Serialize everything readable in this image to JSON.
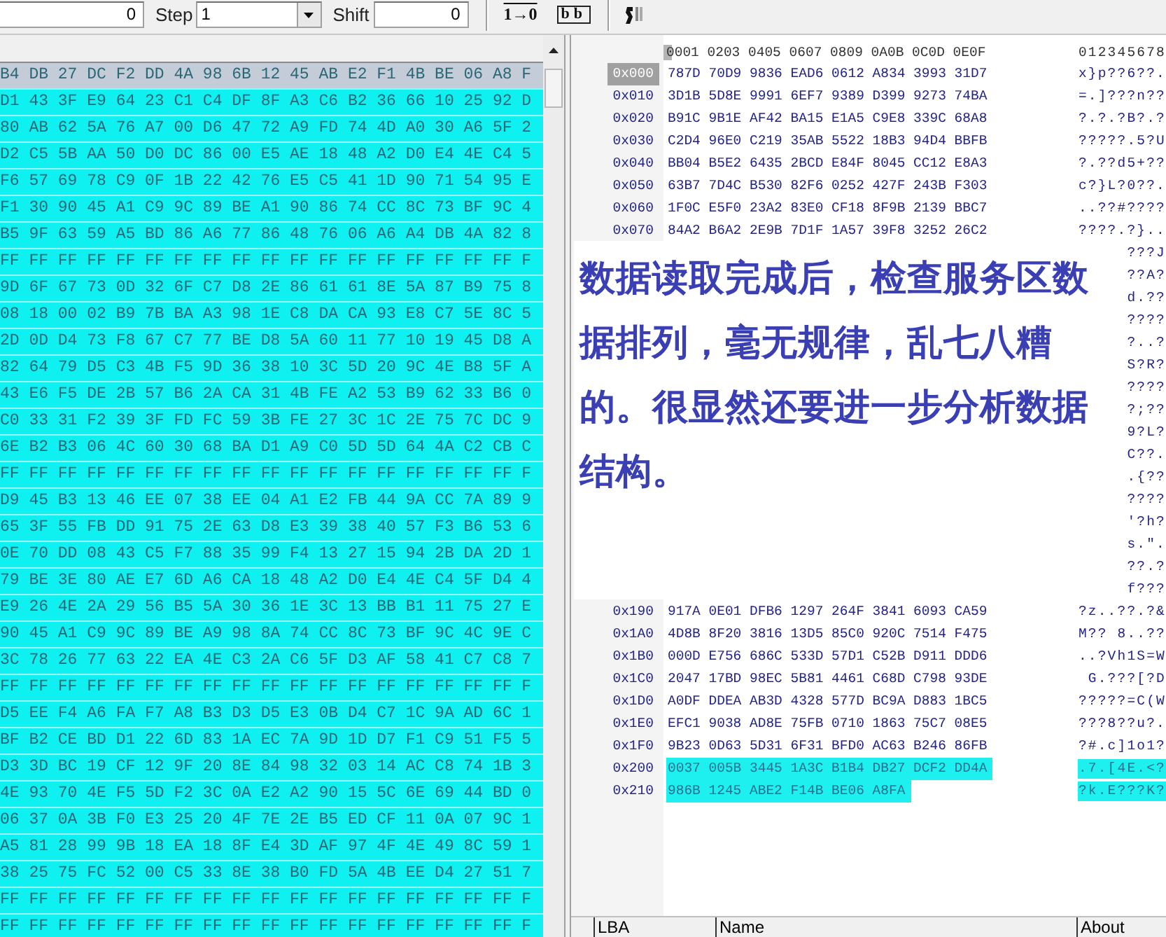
{
  "toolbar": {
    "offset_value": "0",
    "step_label": "Step",
    "step_value": "1",
    "shift_label": "Shift",
    "shift_value": "0",
    "invert_button": "1→0",
    "bytes_button": "bb"
  },
  "left_panel": {
    "rows": [
      {
        "bytes": "B4 DB 27 DC F2 DD 4A 98 6B 12 45 AB E2 F1 4B BE 06 A8 F",
        "current": true
      },
      {
        "bytes": "D1 43 3F E9 64 23 C1 C4 DF 8F A3 C6 B2 36 66 10 25 92 D",
        "current": false
      },
      {
        "bytes": "80 AB 62 5A 76 A7 00 D6 47 72 A9 FD 74 4D A0 30 A6 5F 2",
        "current": false
      },
      {
        "bytes": "D2 C5 5B AA 50 D0 DC 86 00 E5 AE 18 48 A2 D0 E4 4E C4 5",
        "current": false
      },
      {
        "bytes": "F6 57 69 78 C9 0F 1B 22 42 76 E5 C5 41 1D 90 71 54 95 E",
        "current": false
      },
      {
        "bytes": "F1 30 90 45 A1 C9 9C 89 BE A1 90 86 74 CC 8C 73 BF 9C 4",
        "current": false
      },
      {
        "bytes": "B5 9F 63 59 A5 BD 86 A6 77 86 48 76 06 A6 A4 DB 4A 82 8",
        "current": false
      },
      {
        "bytes": "FF FF FF FF FF FF FF FF FF FF FF FF FF FF FF FF FF FF F",
        "current": false
      },
      {
        "bytes": "9D 6F 67 73 0D 32 6F C7 D8 2E 86 61 61 8E 5A 87 B9 75 8",
        "current": false
      },
      {
        "bytes": "08 18 00 02 B9 7B BA A3 98 1E C8 DA CA 93 E8 C7 5E 8C 5",
        "current": false
      },
      {
        "bytes": "2D 0D D4 73 F8 67 C7 77 BE D8 5A 60 11 77 10 19 45 D8 A",
        "current": false
      },
      {
        "bytes": "82 64 79 D5 C3 4B F5 9D 36 38 10 3C 5D 20 9C 4E B8 5F A",
        "current": false
      },
      {
        "bytes": "43 E6 F5 DE 2B 57 B6 2A CA 31 4B FE A2 53 B9 62 33 B6 0",
        "current": false
      },
      {
        "bytes": "C0 33 31 F2 39 3F FD FC 59 3B FE 27 3C 1C 2E 75 7C DC 9",
        "current": false
      },
      {
        "bytes": "6E B2 B3 06 4C 60 30 68 BA D1 A9 C0 5D 5D 64 4A C2 CB C",
        "current": false
      },
      {
        "bytes": "FF FF FF FF FF FF FF FF FF FF FF FF FF FF FF FF FF FF F",
        "current": false
      },
      {
        "bytes": "D9 45 B3 13 46 EE 07 38 EE 04 A1 E2 FB 44 9A CC 7A 89 9",
        "current": false
      },
      {
        "bytes": "65 3F 55 FB DD 91 75 2E 63 D8 E3 39 38 40 57 F3 B6 53 6",
        "current": false
      },
      {
        "bytes": "0E 70 DD 08 43 C5 F7 88 35 99 F4 13 27 15 94 2B DA 2D 1",
        "current": false
      },
      {
        "bytes": "79 BE 3E 80 AE E7 6D A6 CA 18 48 A2 D0 E4 4E C4 5F D4 4",
        "current": false
      },
      {
        "bytes": "E9 26 4E 2A 29 56 B5 5A 30 36 1E 3C 13 BB B1 11 75 27 E",
        "current": false
      },
      {
        "bytes": "90 45 A1 C9 9C 89 BE A9 98 8A 74 CC 8C 73 BF 9C 4C 9E C",
        "current": false
      },
      {
        "bytes": "3C 78 26 77 63 22 EA 4E C3 2A C6 5F D3 AF 58 41 C7 C8 7",
        "current": false
      },
      {
        "bytes": "FF FF FF FF FF FF FF FF FF FF FF FF FF FF FF FF FF FF F",
        "current": false
      },
      {
        "bytes": "D5 EE F4 A6 FA F7 A8 B3 D3 D5 E3 0B D4 C7 1C 9A AD 6C 1",
        "current": false
      },
      {
        "bytes": "BF B2 CE BD D1 22 6D 83 1A EC 7A 9D 1D D7 F1 C9 51 F5 5",
        "current": false
      },
      {
        "bytes": "D3 3D BC 19 CF 12 9F 20 8E 84 98 32 03 14 AC C8 74 1B 3",
        "current": false
      },
      {
        "bytes": "4E 93 70 4E F5 5D F2 3C 0A E2 A2 90 15 5C 6E 69 44 BD 0",
        "current": false
      },
      {
        "bytes": "06 37 0A 3B F0 E3 25 20 4F 7E 2E B5 ED CF 11 0A 07 9C 1",
        "current": false
      },
      {
        "bytes": "A5 81 28 99 9B 18 EA 18 8F E4 3D AF 97 4F 4E 49 8C 59 1",
        "current": false
      },
      {
        "bytes": "38 25 75 FC 52 00 C5 33 8E 38 B0 FD 5A 4B EE D4 27 51 7",
        "current": false
      },
      {
        "bytes": "FF FF FF FF FF FF FF FF FF FF FF FF FF FF FF FF FF FF F",
        "current": false
      },
      {
        "bytes": "FF FF FF FF FF FF FF FF FF FF FF FF FF FF FF FF FF FF F",
        "current": false
      }
    ]
  },
  "right_panel": {
    "header_hex": "0001 0203 0405 0607 0809 0A0B 0C0D 0E0F",
    "header_ascii": "012345678",
    "rows": [
      {
        "offset": "0x000",
        "hex": "787D 70D9 9836 EAD6 0612 A834 3993 31D7",
        "ascii": "x}p??6??.",
        "current": true,
        "selected": false
      },
      {
        "offset": "0x010",
        "hex": "3D1B 5D8E 9991 6EF7 9389 D399 9273 74BA",
        "ascii": "=.]???n??",
        "current": false,
        "selected": false
      },
      {
        "offset": "0x020",
        "hex": "B91C 9B1E AF42 BA15 E1A5 C9E8 339C 68A8",
        "ascii": "?.?.?B?.?",
        "current": false,
        "selected": false
      },
      {
        "offset": "0x030",
        "hex": "C2D4 96E0 C219 35AB 5522 18B3 94D4 BBFB",
        "ascii": "?????.5?U",
        "current": false,
        "selected": false
      },
      {
        "offset": "0x040",
        "hex": "BB04 B5E2 6435 2BCD E84F 8045 CC12 E8A3",
        "ascii": "?.??d5+??",
        "current": false,
        "selected": false
      },
      {
        "offset": "0x050",
        "hex": "63B7 7D4C B530 82F6 0252 427F 243B F303",
        "ascii": "c?}L?0??.",
        "current": false,
        "selected": false
      },
      {
        "offset": "0x060",
        "hex": "1F0C E5F0 23A2 83E0 CF18 8F9B 2139 BBC7",
        "ascii": "..??#????",
        "current": false,
        "selected": false
      },
      {
        "offset": "0x070",
        "hex": "84A2 B6A2 2E9B 7D1F 1A57 39F8 3252 26C2",
        "ascii": "????.?}..",
        "current": false,
        "selected": false
      },
      {
        "ascii": "???J"
      },
      {
        "ascii": "??A?"
      },
      {
        "ascii": "d.??"
      },
      {
        "ascii": "????"
      },
      {
        "ascii": "?..?"
      },
      {
        "ascii": "S?R?"
      },
      {
        "ascii": "????"
      },
      {
        "ascii": "?;??"
      },
      {
        "ascii": "9?L?"
      },
      {
        "ascii": "C??."
      },
      {
        "ascii": ".{??"
      },
      {
        "ascii": "????"
      },
      {
        "ascii": "'?h?"
      },
      {
        "ascii": "s.\"."
      },
      {
        "ascii": "??.?"
      },
      {
        "ascii": "f???"
      },
      {
        "offset": "0x190",
        "hex": "917A 0E01 DFB6 1297 264F 3841 6093 CA59",
        "ascii": "?z..??.?&",
        "current": false,
        "selected": false
      },
      {
        "offset": "0x1A0",
        "hex": "4D8B 8F20 3816 13D5 85C0 920C 7514 F475",
        "ascii": "M?? 8..??",
        "current": false,
        "selected": false
      },
      {
        "offset": "0x1B0",
        "hex": "000D E756 686C 533D 57D1 C52B D911 DDD6",
        "ascii": "..?Vh1S=W",
        "current": false,
        "selected": false
      },
      {
        "offset": "0x1C0",
        "hex": "2047 17BD 98EC 5B81 4461 C68D C798 93DE",
        "ascii": " G.???[?D",
        "current": false,
        "selected": false
      },
      {
        "offset": "0x1D0",
        "hex": "A0DF DDEA AB3D 4328 577D BC9A D883 1BC5",
        "ascii": "?????=C(W",
        "current": false,
        "selected": false
      },
      {
        "offset": "0x1E0",
        "hex": "EFC1 9038 AD8E 75FB 0710 1863 75C7 08E5",
        "ascii": "???8??u?.",
        "current": false,
        "selected": false
      },
      {
        "offset": "0x1F0",
        "hex": "9B23 0D63 5D31 6F31 BFD0 AC63 B246 86FB",
        "ascii": "?#.c]1o1?",
        "current": false,
        "selected": false
      },
      {
        "offset": "0x200",
        "hex": "0037 005B 3445 1A3C B1B4 DB27 DCF2 DD4A",
        "ascii": ".7.[4E.<?",
        "current": false,
        "selected": true
      },
      {
        "offset": "0x210",
        "hex": "986B 1245 ABE2 F14B BE06 A8FA",
        "ascii": "?k.E???K?",
        "current": false,
        "selected": true
      }
    ]
  },
  "note": {
    "text": "数据读取完成后，检查服务区数据排列，毫无规律，乱七八糟的。很显然还要进一步分析数据结构。"
  },
  "bottom_header": {
    "columns": [
      "LBA",
      "Name",
      "About"
    ]
  }
}
